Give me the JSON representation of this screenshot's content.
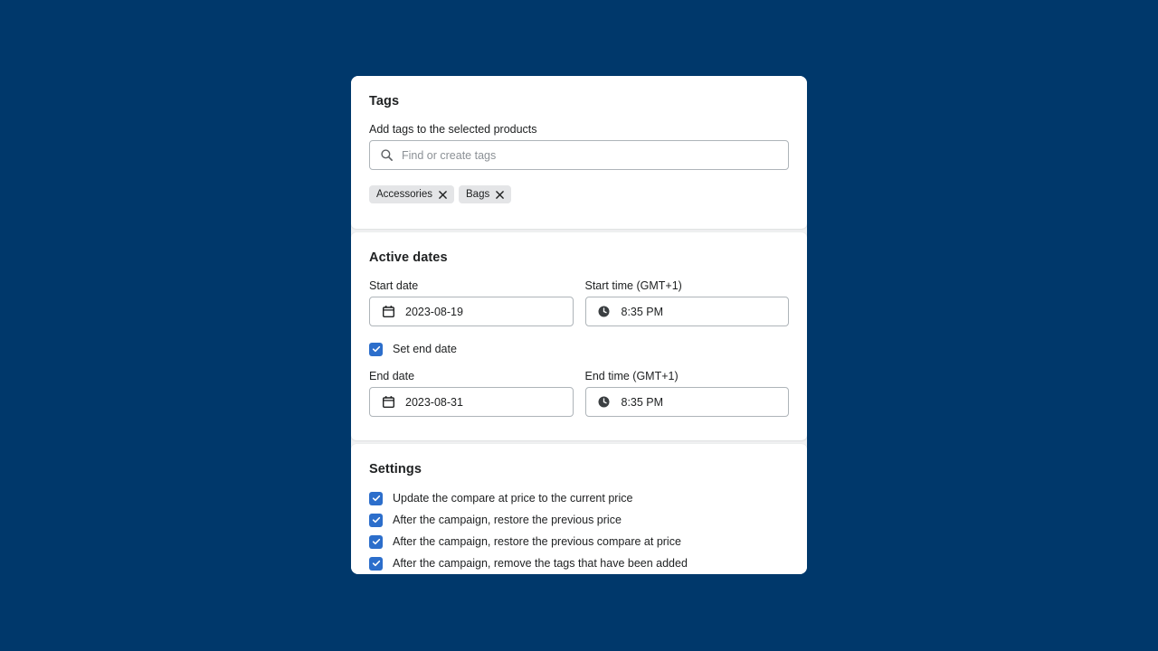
{
  "theme": {
    "page_background": "#00386b",
    "card_background": "#ffffff",
    "shell_background": "#f1f2f3",
    "accent": "#2c6ecb",
    "text": "#202223",
    "placeholder": "#8c9196",
    "border": "#aeb4b9",
    "chip_background": "#e4e5e7"
  },
  "tags_section": {
    "title": "Tags",
    "description": "Add tags to the selected products",
    "search": {
      "icon": "search-icon",
      "value": "",
      "placeholder": "Find or create tags"
    },
    "chips": [
      {
        "label": "Accessories",
        "remove_icon": "close-icon"
      },
      {
        "label": "Bags",
        "remove_icon": "close-icon"
      }
    ]
  },
  "active_dates_section": {
    "title": "Active dates",
    "start_date": {
      "label": "Start date",
      "icon": "calendar-icon",
      "value": "2023-08-19"
    },
    "start_time": {
      "label": "Start time (GMT+1)",
      "icon": "clock-icon",
      "value": "8:35 PM"
    },
    "set_end_date": {
      "label": "Set end date",
      "checked": true
    },
    "end_date": {
      "label": "End date",
      "icon": "calendar-icon",
      "value": "2023-08-31"
    },
    "end_time": {
      "label": "End time (GMT+1)",
      "icon": "clock-icon",
      "value": "8:35 PM"
    }
  },
  "settings_section": {
    "title": "Settings",
    "options": [
      {
        "label": "Update the compare at price to the current price",
        "checked": true
      },
      {
        "label": "After the campaign, restore the previous price",
        "checked": true
      },
      {
        "label": "After the campaign, restore the previous compare at price",
        "checked": true
      },
      {
        "label": "After the campaign, remove the tags that have been added",
        "checked": true
      }
    ]
  }
}
